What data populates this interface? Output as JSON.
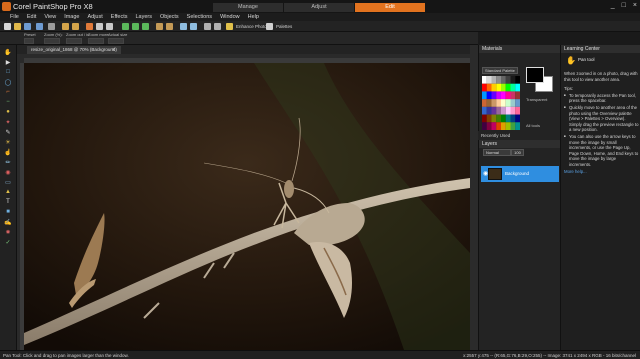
{
  "app": {
    "title": "Corel PaintShop Pro X8"
  },
  "window_controls": [
    "_",
    "□",
    "×"
  ],
  "mode_tabs": [
    {
      "label": "Manage",
      "active": false
    },
    {
      "label": "Adjust",
      "active": false
    },
    {
      "label": "Edit",
      "active": true
    }
  ],
  "menu": [
    "File",
    "Edit",
    "View",
    "Image",
    "Adjust",
    "Effects",
    "Layers",
    "Objects",
    "Selections",
    "Window",
    "Help"
  ],
  "toolbar": {
    "enhance_label": "Enhance Photo",
    "palettes_label": "Palettes"
  },
  "tool_options": {
    "items": [
      "Preset",
      "Zoom (%):",
      "Zoom out / in",
      "Zoom more",
      "Actual size"
    ]
  },
  "document": {
    "tab_label": "resize_original_1868 @ 70% (Background)"
  },
  "materials": {
    "title": "Materials",
    "swatch_select": "Standard Palette",
    "transparent": "Transparent",
    "all_tools": "All tools",
    "swatch_colors": [
      [
        "#ffffff",
        "#d9d9d9",
        "#b3b3b3",
        "#8c8c8c",
        "#666666",
        "#3f3f3f",
        "#1a1a1a",
        "#000000"
      ],
      [
        "#ff0000",
        "#ff6600",
        "#ffcc00",
        "#ffff00",
        "#99ff00",
        "#00ff00",
        "#00ff99",
        "#00ffff"
      ],
      [
        "#0099ff",
        "#0000ff",
        "#6600ff",
        "#cc00ff",
        "#ff00ff",
        "#ff0099",
        "#cc3366",
        "#993333"
      ],
      [
        "#cc6633",
        "#996633",
        "#cc9966",
        "#ffcc99",
        "#ffffcc",
        "#ccffcc",
        "#99cccc",
        "#6699cc"
      ],
      [
        "#3366cc",
        "#333399",
        "#663399",
        "#996699",
        "#cc99cc",
        "#ffccff",
        "#ff99cc",
        "#ff6699"
      ],
      [
        "#800000",
        "#804000",
        "#808000",
        "#408000",
        "#008000",
        "#008080",
        "#004080",
        "#000080"
      ],
      [
        "#400040",
        "#800040",
        "#c00060",
        "#e04000",
        "#e0a000",
        "#a0c000",
        "#40a040",
        "#009090"
      ]
    ]
  },
  "recently_used": {
    "label": "Recently Used"
  },
  "layers": {
    "title": "Layers",
    "blend_mode": "Normal",
    "opacity": "100",
    "layer_name": "Background"
  },
  "learning_center": {
    "title": "Learning Center",
    "tool_name": "Pan tool",
    "intro": "When zoomed in on a photo, drag with this tool to view another area.",
    "tips_heading": "Tips:",
    "tips": [
      "To temporarily access the Pan tool, press the spacebar.",
      "Quickly move to another area of the photo using the Overview palette (View > Palettes > Overview). Simply drag the preview rectangle to a new position.",
      "You can also use the arrow keys to move the image by small increments, or use the Page Up, Page Down, Home, and End keys to move the image by large increments."
    ],
    "more_help": "More help..."
  },
  "status": {
    "left": "Pan Tool: Click and drag to pan images larger than the window.",
    "right": "x:2557 y:475 -- (R:65,G:76,B:29,O:255) -- Image: 3741 x 2494 x RGB - 16 bits/channel"
  },
  "colors": {
    "accent": "#e2731f",
    "selection": "#2f8ee0",
    "link": "#5ba3e6"
  }
}
